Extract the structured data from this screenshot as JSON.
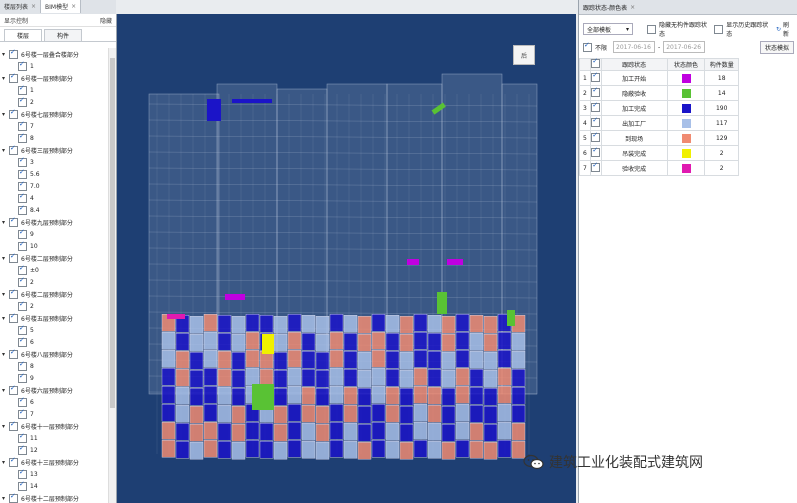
{
  "tabs": [
    {
      "label": "楼层列表"
    },
    {
      "label": "BIM模型"
    }
  ],
  "left_panel": {
    "header_left": "显示控制",
    "header_right": "隐藏",
    "subtabs": [
      "楼层",
      "构件"
    ],
    "tree": [
      {
        "kind": "group",
        "label": "6号楼一层叠合楼部分"
      },
      {
        "kind": "child",
        "label": "1"
      },
      {
        "kind": "group",
        "label": "6号楼一层预制部分"
      },
      {
        "kind": "child",
        "label": "1"
      },
      {
        "kind": "child",
        "label": "2"
      },
      {
        "kind": "group",
        "label": "6号楼七层预制部分"
      },
      {
        "kind": "child",
        "label": "7"
      },
      {
        "kind": "child",
        "label": "8"
      },
      {
        "kind": "group",
        "label": "6号楼三层预制部分"
      },
      {
        "kind": "child",
        "label": "3"
      },
      {
        "kind": "child",
        "label": "5.6"
      },
      {
        "kind": "child",
        "label": "7.0"
      },
      {
        "kind": "child",
        "label": "4"
      },
      {
        "kind": "child",
        "label": "8.4"
      },
      {
        "kind": "group",
        "label": "6号楼九层预制部分"
      },
      {
        "kind": "child",
        "label": "9"
      },
      {
        "kind": "child",
        "label": "10"
      },
      {
        "kind": "group",
        "label": "6号楼二层预制部分"
      },
      {
        "kind": "child",
        "label": "±0"
      },
      {
        "kind": "child",
        "label": "2"
      },
      {
        "kind": "group",
        "label": "6号楼二层预制部分"
      },
      {
        "kind": "child",
        "label": "2"
      },
      {
        "kind": "group",
        "label": "6号楼五层预制部分"
      },
      {
        "kind": "child",
        "label": "5"
      },
      {
        "kind": "child",
        "label": "6"
      },
      {
        "kind": "group",
        "label": "6号楼八层预制部分"
      },
      {
        "kind": "child",
        "label": "8"
      },
      {
        "kind": "child",
        "label": "9"
      },
      {
        "kind": "group",
        "label": "6号楼六层预制部分"
      },
      {
        "kind": "child",
        "label": "6"
      },
      {
        "kind": "child",
        "label": "7"
      },
      {
        "kind": "group",
        "label": "6号楼十一层预制部分"
      },
      {
        "kind": "child",
        "label": "11"
      },
      {
        "kind": "child",
        "label": "12"
      },
      {
        "kind": "group",
        "label": "6号楼十三层预制部分"
      },
      {
        "kind": "child",
        "label": "13"
      },
      {
        "kind": "child",
        "label": "14"
      },
      {
        "kind": "group",
        "label": "6号楼十二层预制部分"
      }
    ]
  },
  "viewcube": {
    "label": "后"
  },
  "right_panel": {
    "title": "跟踪状态-颜色表",
    "model_select": "全部模板",
    "hide_no_info": "隐藏无构件跟踪状态",
    "show_history": "显示历史跟踪状态",
    "refresh": "刷新",
    "unlimited": "不限",
    "date_from": "2017-06-16",
    "date_to": "2017-06-26",
    "state_model_btn": "状态模拟",
    "columns": [
      "跟踪状态",
      "状态颜色",
      "构件数量"
    ],
    "rows": [
      {
        "no": "1",
        "state": "加工开始",
        "color": "#c000e0",
        "count": "18"
      },
      {
        "no": "2",
        "state": "隐蔽验收",
        "color": "#59c234",
        "count": "14"
      },
      {
        "no": "3",
        "state": "加工完成",
        "color": "#1b14c8",
        "count": "190"
      },
      {
        "no": "4",
        "state": "出加工厂",
        "color": "#a8c0e8",
        "count": "117"
      },
      {
        "no": "5",
        "state": "到现场",
        "color": "#f08b72",
        "count": "129"
      },
      {
        "no": "6",
        "state": "吊装完成",
        "color": "#f0f000",
        "count": "2"
      },
      {
        "no": "7",
        "state": "验收完成",
        "color": "#e01ab0",
        "count": "2"
      }
    ]
  },
  "watermark": "建筑工业化装配式建筑网"
}
